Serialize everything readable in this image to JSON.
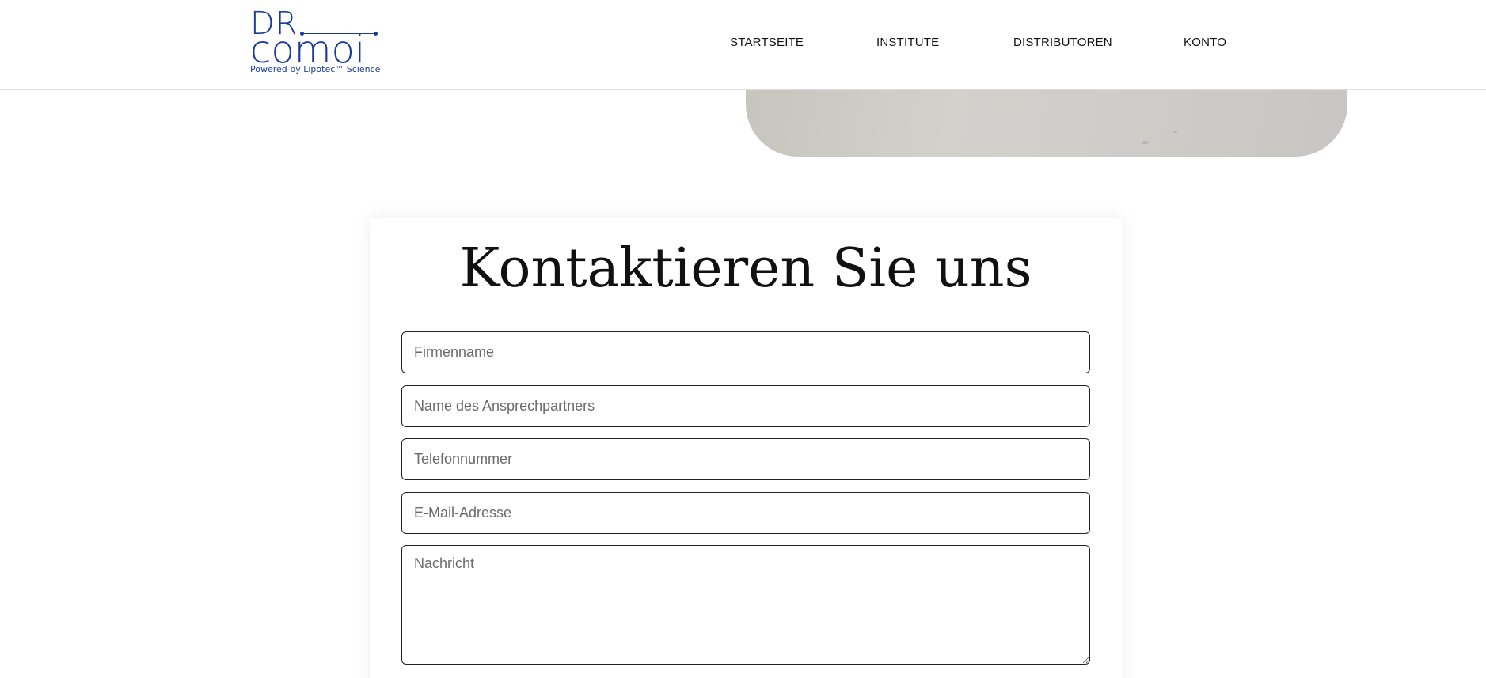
{
  "header": {
    "logo": {
      "top": "DR",
      "bottom": "comoi",
      "tagline": "Powered by Lipotec™ Science"
    },
    "nav": [
      {
        "label": "STARTSEITE"
      },
      {
        "label": "INSTITUTE"
      },
      {
        "label": "DISTRIBUTOREN"
      },
      {
        "label": "KONTO"
      }
    ]
  },
  "contact": {
    "title": "Kontaktieren Sie uns",
    "fields": {
      "company": {
        "placeholder": "Firmenname",
        "value": ""
      },
      "contact_person": {
        "placeholder": "Name des Ansprechpartners",
        "value": ""
      },
      "phone": {
        "placeholder": "Telefonnummer",
        "value": ""
      },
      "email": {
        "placeholder": "E-Mail-Adresse",
        "value": ""
      },
      "message": {
        "placeholder": "Nachricht",
        "value": ""
      }
    }
  },
  "colors": {
    "brand": "#1a3d9c",
    "text": "#111111",
    "border": "#222222",
    "placeholder": "#6b6b6b"
  }
}
